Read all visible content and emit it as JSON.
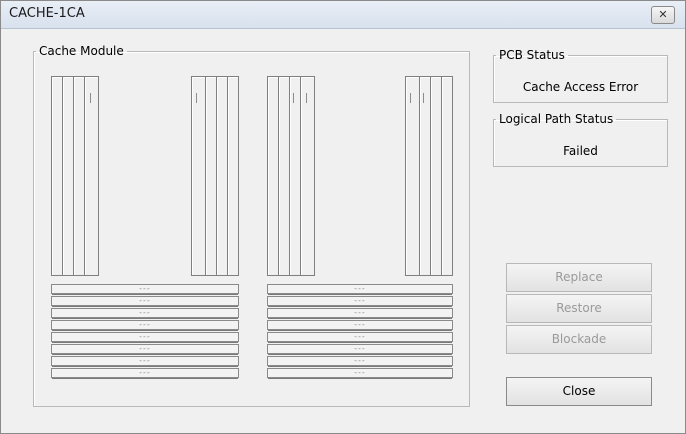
{
  "window": {
    "title": "CACHE-1CA"
  },
  "cache_module": {
    "label": "Cache Module",
    "row_placeholder": "---"
  },
  "pcb_status": {
    "label": "PCB Status",
    "value": "Cache Access Error"
  },
  "logical_path_status": {
    "label": "Logical Path Status",
    "value": "Failed"
  },
  "buttons": {
    "replace": "Replace",
    "restore": "Restore",
    "blockade": "Blockade",
    "close": "Close"
  }
}
